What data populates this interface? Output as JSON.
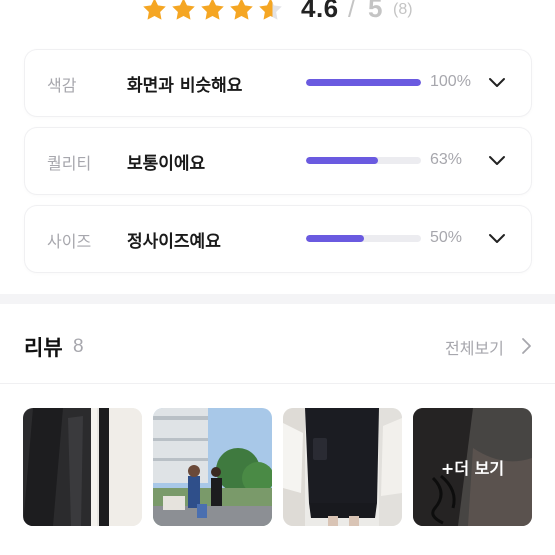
{
  "rating": {
    "score": "4.6",
    "slash": "/",
    "max": "5",
    "count": "(8)",
    "stars_filled": 4.6,
    "star_color": "#f5a623"
  },
  "criteria": [
    {
      "category": "색감",
      "value": "화면과 비슷해요",
      "percent_text": "100%",
      "percent": 100
    },
    {
      "category": "퀄리티",
      "value": "보통이에요",
      "percent_text": "63%",
      "percent": 63
    },
    {
      "category": "사이즈",
      "value": "정사이즈예요",
      "percent_text": "50%",
      "percent": 50
    }
  ],
  "accent_color": "#6a5ae0",
  "reviews": {
    "title": "리뷰",
    "count": "8",
    "see_all": "전체보기",
    "more_label": "+더 보기",
    "photos": [
      "review-photo-jacket-closeup",
      "review-photo-couple-outdoor",
      "review-photo-mirror-selfie",
      "review-photo-more"
    ]
  }
}
